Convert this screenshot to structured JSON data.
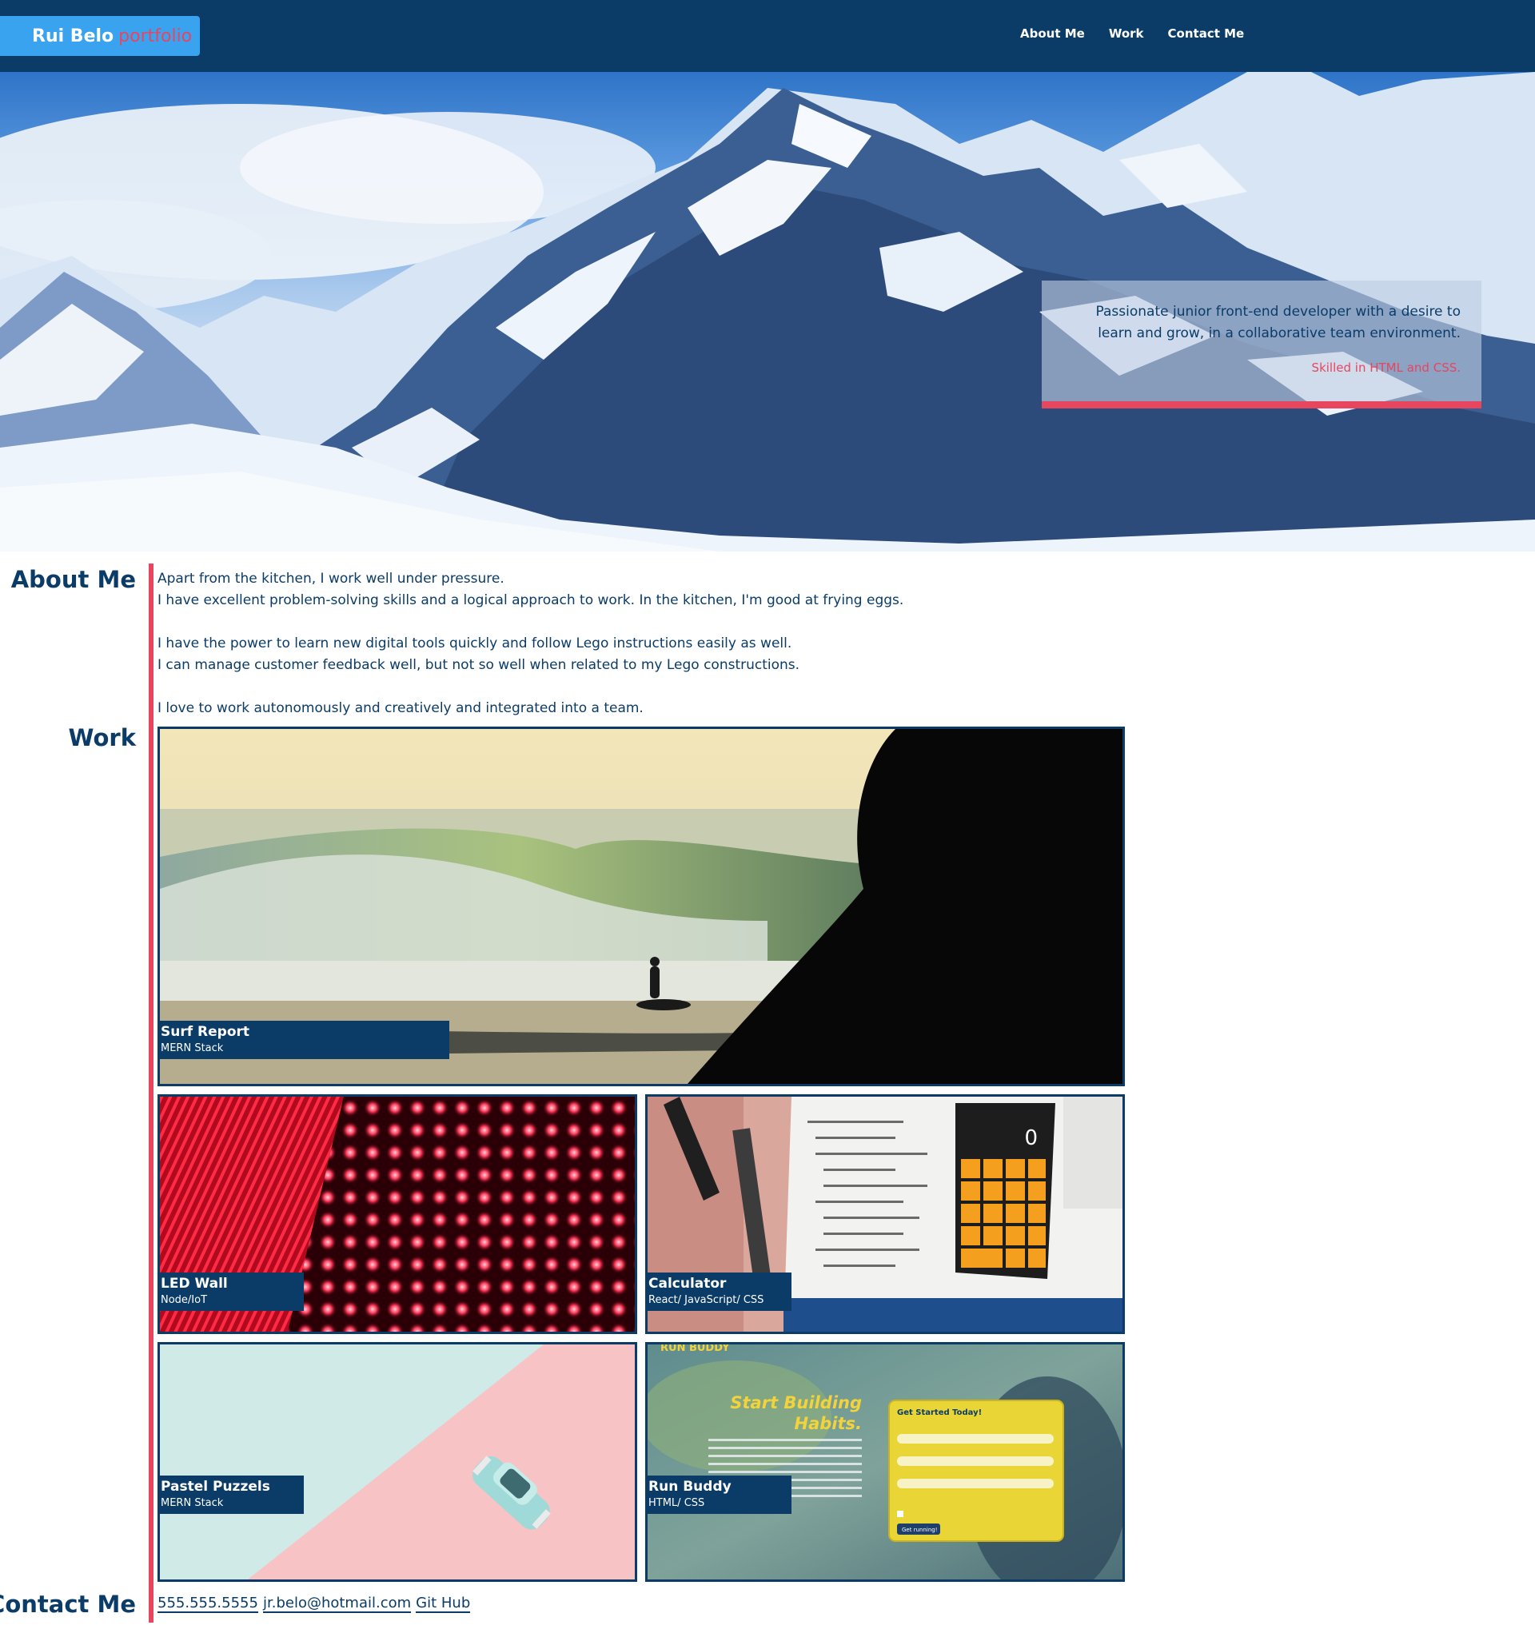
{
  "header": {
    "brand_name": "Rui Belo",
    "brand_tag": "portfolio",
    "nav": [
      "About Me",
      "Work",
      "Contact Me"
    ]
  },
  "hero": {
    "tagline": "Passionate junior front-end developer with a desire to learn and grow, in a collaborative team environment.",
    "skills": "Skilled in HTML and CSS."
  },
  "about": {
    "title": "About Me",
    "paragraphs": [
      [
        "Apart from the kitchen, I work well under pressure.",
        "I have excellent problem-solving skills and a logical approach to work. In the kitchen, I'm good at frying eggs."
      ],
      [
        "I have the power to learn new digital tools quickly and follow Lego instructions easily as well.",
        "I can manage customer feedback well, but not so well when related to my Lego constructions."
      ],
      [
        "I love to work autonomously and creatively and integrated into a team."
      ]
    ]
  },
  "work": {
    "title": "Work",
    "projects": [
      {
        "title": "Surf Report",
        "stack": "MERN Stack"
      },
      {
        "title": "LED Wall",
        "stack": "Node/IoT"
      },
      {
        "title": "Calculator",
        "stack": "React/ JavaScript/ CSS"
      },
      {
        "title": "Pastel Puzzels",
        "stack": "MERN Stack"
      },
      {
        "title": "Run Buddy",
        "stack": "HTML/ CSS"
      }
    ],
    "calculator_display": "0",
    "run_buddy": {
      "logo": "RUN BUDDY",
      "headline_1": "Start Building",
      "headline_2": "Habits.",
      "form_title": "Get Started Today!",
      "form_button": "Get running!"
    }
  },
  "contact": {
    "title": "Contact Me",
    "phone": "555.555.5555",
    "email": "jr.belo@hotmail.com",
    "github": "Git Hub"
  },
  "colors": {
    "navy": "#0b3c68",
    "accent_red": "#e8455e",
    "brand_blue": "#3aa3ef"
  }
}
